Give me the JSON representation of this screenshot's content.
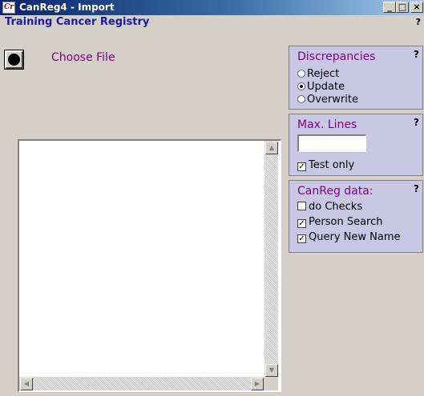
{
  "window": {
    "app_icon_text": "Cr",
    "title": "CanReg4 - Import",
    "minimize": "_",
    "maximize": "□",
    "close": "×"
  },
  "subtitle": "Training Cancer Registry",
  "top_help": "?",
  "choose_file": {
    "label": "Choose File"
  },
  "discrepancies": {
    "title": "Discrepancies",
    "help": "?",
    "options": [
      {
        "label": "Reject",
        "selected": false
      },
      {
        "label": "Update",
        "selected": true
      },
      {
        "label": "Overwrite",
        "selected": false
      }
    ]
  },
  "max_lines": {
    "title": "Max. Lines",
    "help": "?",
    "value": "",
    "test_only": {
      "label": "Test only",
      "checked": true
    }
  },
  "canreg_data": {
    "title": "CanReg data:",
    "help": "?",
    "options": [
      {
        "label": "do Checks",
        "checked": false
      },
      {
        "label": "Person Search",
        "checked": true
      },
      {
        "label": "Query New Name",
        "checked": true
      }
    ]
  },
  "scroll": {
    "up": "▲",
    "down": "▼",
    "left": "◀",
    "right": "▶"
  }
}
